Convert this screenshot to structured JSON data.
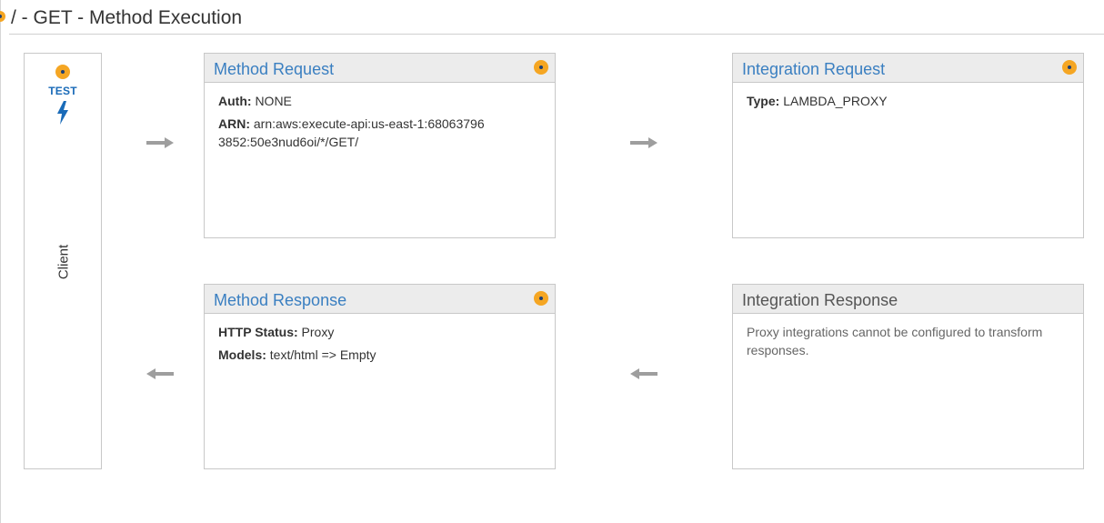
{
  "page": {
    "title": "/ - GET - Method Execution"
  },
  "client": {
    "test_label": "TEST",
    "label": "Client",
    "icons": [
      "status-dot-icon",
      "lightning-bolt-icon"
    ]
  },
  "method_request": {
    "title": "Method Request",
    "auth_key": "Auth:",
    "auth_value": "NONE",
    "arn_key": "ARN:",
    "arn_value": "arn:aws:execute-api:us-east-1:680637963852:50e3nud6oi/*/GET/"
  },
  "integration_request": {
    "title": "Integration Request",
    "type_key": "Type:",
    "type_value": "LAMBDA_PROXY"
  },
  "method_response": {
    "title": "Method Response",
    "status_key": "HTTP Status:",
    "status_value": "Proxy",
    "models_key": "Models:",
    "models_value": "text/html => Empty"
  },
  "integration_response": {
    "title": "Integration Response",
    "note": "Proxy integrations cannot be configured to transform responses."
  },
  "colors": {
    "link_blue": "#3a7fc1",
    "test_blue": "#1a6bb8",
    "dot_orange": "#f5a623",
    "arrow_gray": "#9e9e9e"
  }
}
